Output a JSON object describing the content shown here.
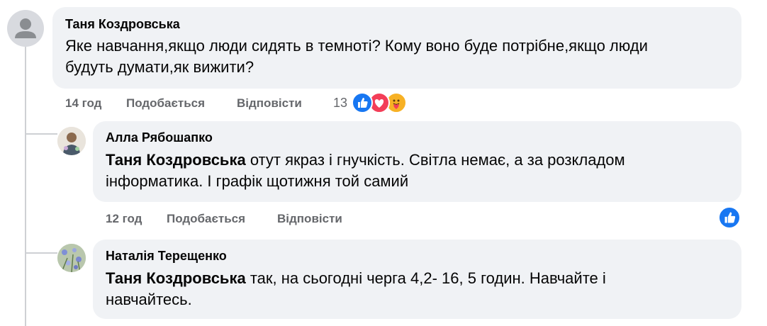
{
  "comments": [
    {
      "author": "Таня Коздровська",
      "text_line1": "Яке навчання,якщо люди сидять в темноті? Кому воно буде потрібне,якщо люди",
      "text_line2": "будуть думати,як вижити?",
      "time": "14 год",
      "like_label": "Подобається",
      "reply_label": "Відповісти",
      "reaction_count": "13",
      "reactions": [
        "like-icon",
        "love-icon",
        "care-icon"
      ]
    },
    {
      "author": "Алла Рябошапко",
      "mention": "Таня Коздровська",
      "text_line1_rest": " отут якраз і гнучкість. Світла немає, а за розкладом",
      "text_line2": "інформатика. І графік щотижня той самий",
      "time": "12 год",
      "like_label": "Подобається",
      "reply_label": "Відповісти",
      "reactions": [
        "like-icon"
      ]
    },
    {
      "author": "Наталія Терещенко",
      "mention": "Таня Коздровська",
      "text_line1_rest": " так, на сьогодні черга 4,2- 16, 5 годин. Навчайте і",
      "text_line2": "навчайтесь."
    }
  ],
  "colors": {
    "bubble": "#f0f2f5",
    "meta_text": "#65676b",
    "like_blue": "#1877f2",
    "love_red": "#f33e58",
    "care_yellow": "#f7b125"
  }
}
